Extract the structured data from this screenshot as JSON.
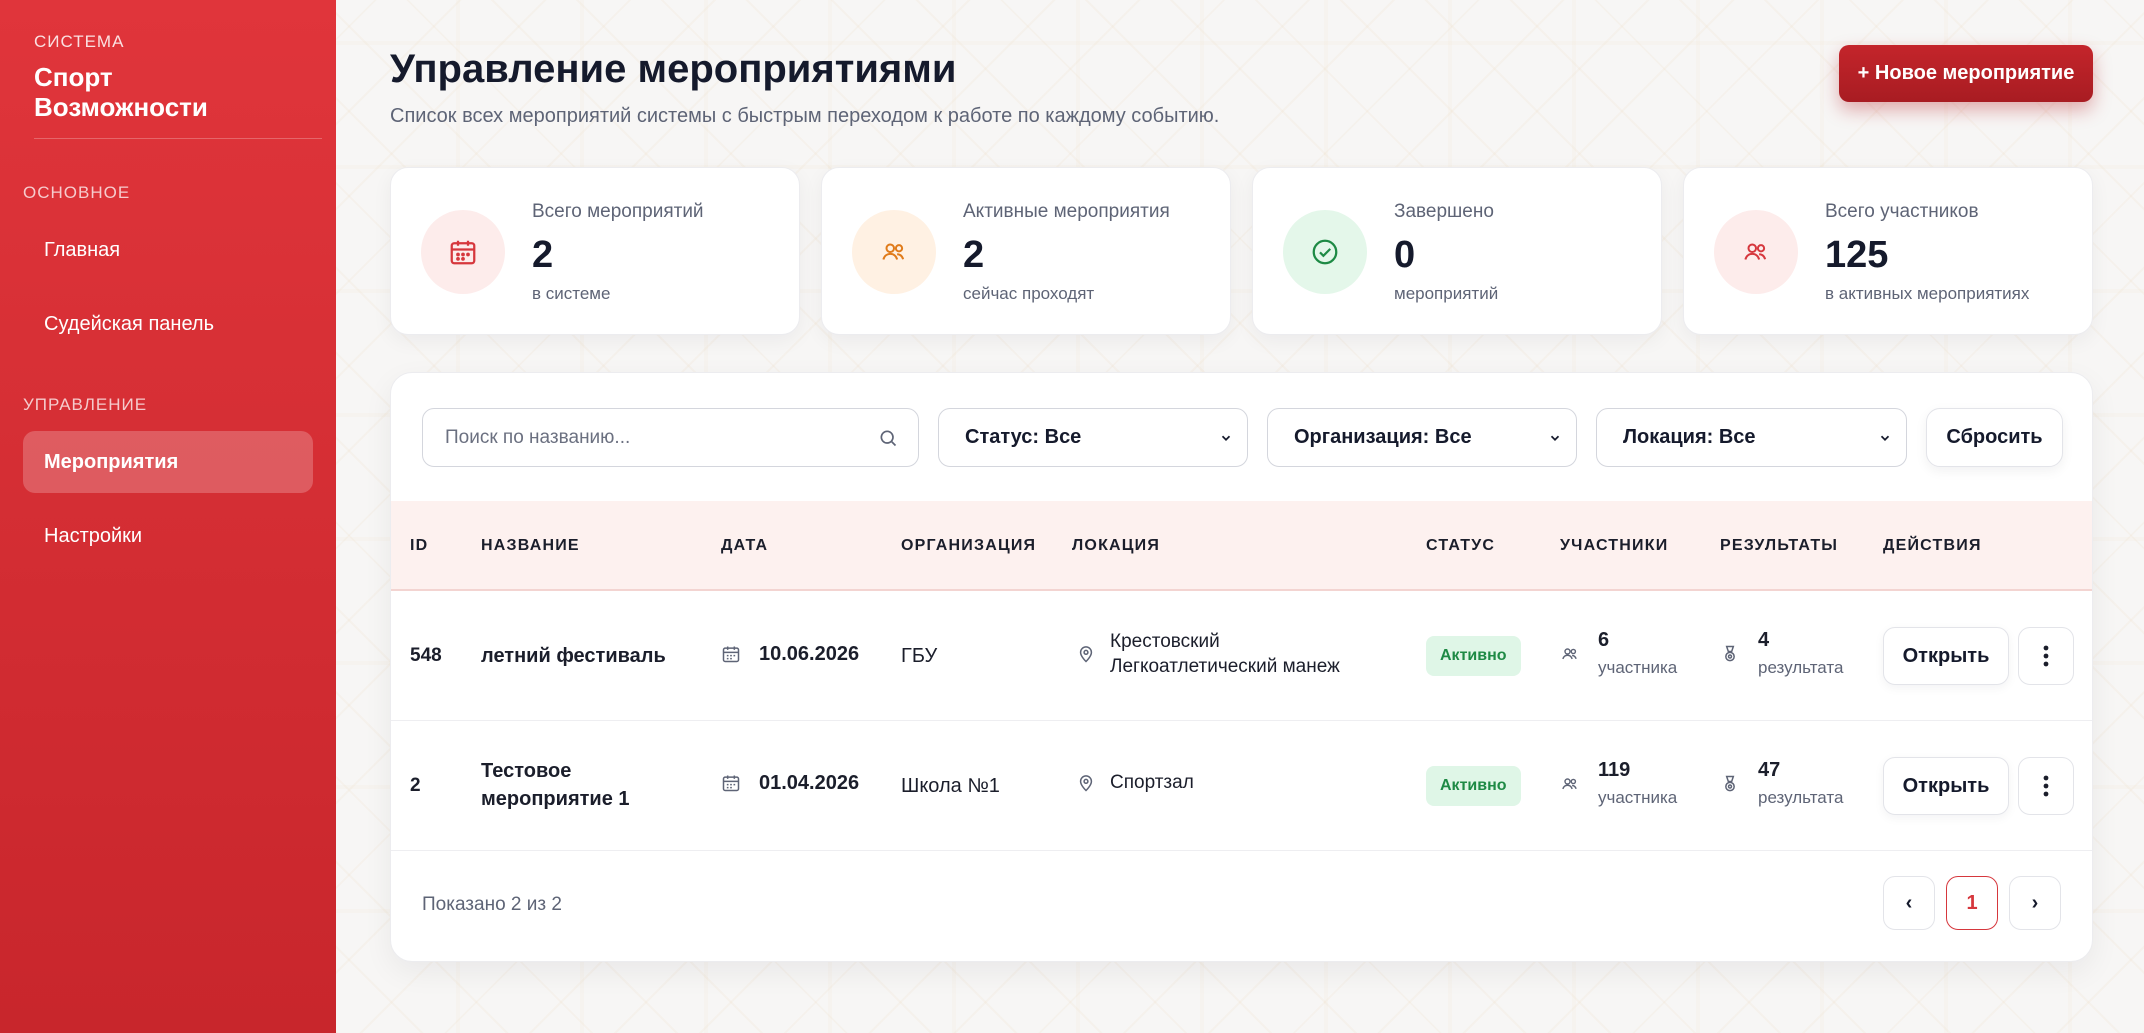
{
  "sidebar": {
    "brand_sub": "СИСТЕМА",
    "brand_title": "Спорт Возможности",
    "section_main": "ОСНОВНОЕ",
    "section_manage": "УПРАВЛЕНИЕ",
    "items": [
      {
        "label": "Главная"
      },
      {
        "label": "Судейская панель"
      },
      {
        "label": "Мероприятия"
      },
      {
        "label": "Настройки"
      }
    ]
  },
  "header": {
    "title": "Управление мероприятиями",
    "subtitle": "Список всех мероприятий системы с быстрым переходом к работе по каждому событию.",
    "new_button": "+ Новое мероприятие"
  },
  "stats": [
    {
      "label": "Всего мероприятий",
      "value": "2",
      "note": "в системе",
      "icon": "calendar-icon",
      "color": "#d6373d",
      "bg": "#fdeceb"
    },
    {
      "label": "Активные мероприятия",
      "value": "2",
      "note": "сейчас проходят",
      "icon": "people-icon",
      "color": "#e07b1a",
      "bg": "#fff1e3"
    },
    {
      "label": "Завершено",
      "value": "0",
      "note": "мероприятий",
      "icon": "check-circle-icon",
      "color": "#1e8a45",
      "bg": "#e4f7ea"
    },
    {
      "label": "Всего участников",
      "value": "125",
      "note": "в активных мероприятиях",
      "icon": "people-icon",
      "color": "#d6373d",
      "bg": "#fdeceb"
    }
  ],
  "filters": {
    "search_placeholder": "Поиск по названию...",
    "status": "Статус: Все",
    "organization": "Организация: Все",
    "location": "Локация: Все",
    "reset": "Сбросить"
  },
  "table": {
    "headers": [
      "ID",
      "НАЗВАНИЕ",
      "ДАТА",
      "ОРГАНИЗАЦИЯ",
      "ЛОКАЦИЯ",
      "СТАТУС",
      "УЧАСТНИКИ",
      "РЕЗУЛЬТАТЫ",
      "ДЕЙСТВИЯ"
    ],
    "rows": [
      {
        "id": "548",
        "name_line1": "летний фестиваль",
        "name_line2": "",
        "date": "10.06.2026",
        "organization": "ГБУ",
        "location_line1": "Крестовский",
        "location_line2": "Легкоатлетический манеж",
        "status": "Активно",
        "participants": "6",
        "participants_label": "участника",
        "results": "4",
        "results_label": "результата",
        "action": "Открыть"
      },
      {
        "id": "2",
        "name_line1": "Тестовое",
        "name_line2": "мероприятие 1",
        "date": "01.04.2026",
        "organization": "Школа №1",
        "location_line1": "Спортзал",
        "location_line2": "",
        "status": "Активно",
        "participants": "119",
        "participants_label": "участника",
        "results": "47",
        "results_label": "результата",
        "action": "Открыть"
      }
    ]
  },
  "footer": {
    "shown": "Показано 2 из 2",
    "prev": "‹",
    "page": "1",
    "next": "›"
  },
  "colors": {
    "accent": "#d6373d",
    "sidebar_top": "#e0353b",
    "sidebar_bottom": "#c8262c",
    "active_badge_bg": "#dff6e7",
    "active_badge_text": "#1e8a45"
  }
}
